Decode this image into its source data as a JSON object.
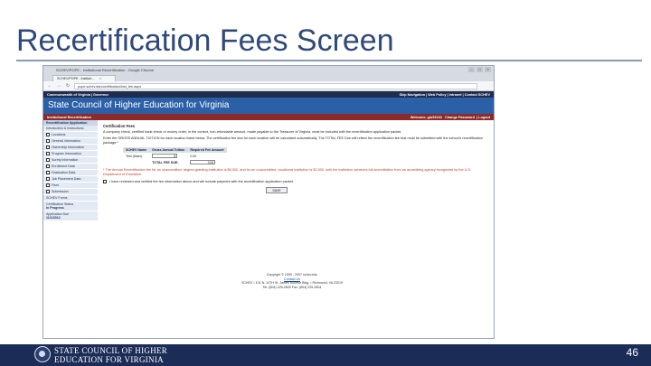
{
  "slide": {
    "title": "Recertification Fees Screen",
    "page_number": "46",
    "footer_org_line1": "STATE COUNCIL OF HIGHER",
    "footer_org_line2": "EDUCATION FOR VIRGINIA"
  },
  "browser": {
    "window_title": "SCHEV/POPE - Institutional Recertification - Google Chrome",
    "tab_label": "SCHEV/POPE - Instituti...",
    "url": "pope.schev.edu/certification/inst_fee.aspx",
    "back": "←",
    "forward": "→",
    "reload": "↻",
    "min": "–",
    "max": "□",
    "close": "×",
    "tab_close": "×"
  },
  "site": {
    "gov_left": "Commonwealth of Virginia | Governor",
    "gov_right": "Skip Navigation | Web Policy | Intranet | Contact SCHEV",
    "banner": "State Council of Higher Education for Virginia",
    "section": "Institutional Recertification",
    "welcome": "Welcome, glu53163",
    "change_password": "Change Password",
    "logout": "Logout"
  },
  "sidebar": {
    "header": "Recertification Application",
    "intro": "Introduction & Instructions",
    "items": [
      "Locations",
      "General Information",
      "Ownership Information",
      "Program Information",
      "Surety Information",
      "Enrollment Data",
      "Graduation Data",
      "Job Placement Data",
      "Fees",
      "Submission"
    ],
    "forms": "SCHEV Forms",
    "status_label": "Certification Status",
    "status_value": "In Progress",
    "due_label": "Application Due",
    "due_value": "11/1/2012"
  },
  "main": {
    "heading": "Certification Fees",
    "para1": "A company check, certified bank check or money order, in the correct, non-refundable amount, made payable to the Treasurer of Virginia, must be included with the recertification application packet.",
    "para2": "Enter the GROSS ANNUAL TUITION for each location listed below. The certification fee due for each location will be calculated automatically. The TOTAL FEE Due will reflect the recertification fee that must be submitted with the school's recertification package.*",
    "col_name": "SCHEV Name",
    "col_tuition": "Gross Annual Tuition",
    "col_fee": "Required Fee Amount",
    "row_name": "Test (Main)",
    "row_tuition": "$",
    "row_fee": "0.00",
    "total_label": "TOTAL FEE DUE:",
    "total_value": "0.00",
    "notice": "* The Annual Recertification fee for an unaccredited, degree-granting institution is $6,000, and for an unaccredited, vocational institution is $2,500, until the institution achieves full accreditation from an accrediting agency recognized by the U.S. Department of Education.",
    "agree": "I have reviewed and verified the fee information above and will include payment with the recertification application packet.",
    "save": "SAVE"
  },
  "footer": {
    "copyright": "Copyright © 1999 - 2007 schev.edu",
    "contact": "Contact Us",
    "address": "SCHEV • 101 N. 14TH St. James Monroe Bldg. • Richmond, VA 23219",
    "phone": "Tel: (804) 225-2600 Fax: (804) 225-2604"
  },
  "colors": {
    "title": "#2f4a7a",
    "banner": "#2b5fa6",
    "gov_bar": "#1f2d4e",
    "status_bar": "#8a2a2a",
    "bottom_band": "#1b2c57"
  }
}
